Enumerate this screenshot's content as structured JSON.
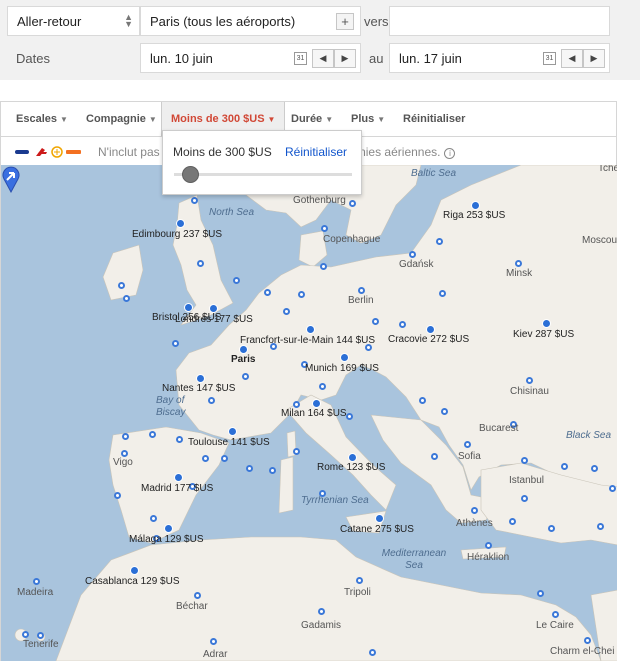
{
  "search": {
    "trip_type": "Aller-retour",
    "origin": "Paris (tous les aéroports)",
    "add_label": "+",
    "vers_label": "vers",
    "destination_value": "",
    "dates_label": "Dates",
    "depart_date": "lun. 10 juin",
    "au_label": "au",
    "return_date": "lun. 17 juin",
    "cal_label": "31",
    "prev": "◀",
    "next": "▶"
  },
  "filters": {
    "stops": "Escales",
    "airline": "Compagnie",
    "price": "Moins de 300 $US",
    "duration": "Durée",
    "more": "Plus",
    "reset": "Réinitialiser",
    "caret": "▼"
  },
  "airline_note": "N'inclut pas les tarifs de certaines autres compagnies aériennes.",
  "info_icon": "i",
  "price_popup": {
    "label": "Moins de 300 $US",
    "reset": "Réinitialiser",
    "slider_fraction": 0.1
  },
  "map": {
    "origin_label": "Paris",
    "cities": [
      {
        "name": "Edimbourg 237 $US"
      },
      {
        "name": "Bristol 256 $US"
      },
      {
        "name": "Londres 177 $US"
      },
      {
        "name": "Riga 253 $US"
      },
      {
        "name": "Francfort-sur-le-Main 144 $US"
      },
      {
        "name": "Cracovie 272 $US"
      },
      {
        "name": "Kiev 287 $US"
      },
      {
        "name": "Munich 169 $US"
      },
      {
        "name": "Nantes 147 $US"
      },
      {
        "name": "Milan 164 $US"
      },
      {
        "name": "Toulouse 141 $US"
      },
      {
        "name": "Rome 123 $US"
      },
      {
        "name": "Madrid 177 $US"
      },
      {
        "name": "Málaga 129 $US"
      },
      {
        "name": "Catane 275 $US"
      },
      {
        "name": "Casablanca 129 $US"
      }
    ],
    "places": [
      "Gothenburg",
      "Copenhague",
      "Berlin",
      "Gdańsk",
      "Minsk",
      "Moscou",
      "Chisinau",
      "Bucarest",
      "Sofia",
      "Istanbul",
      "Athènes",
      "Héraklion",
      "Le Caire",
      "Charm el-Chei",
      "Tripoli",
      "Béchar",
      "Gadamis",
      "Adrar",
      "Madeira",
      "Tenerife",
      "Vigo",
      "Tche"
    ],
    "seas": [
      "North Sea",
      "Baltic Sea",
      "Bay of Biscay",
      "Black Sea",
      "Tyrrhenian Sea",
      "Mediterranean Sea"
    ]
  },
  "colors": {
    "accent_red": "#d14836",
    "link_blue": "#1155cc",
    "sea": "#a9c4dd",
    "land": "#f2efe9",
    "marker": "#2b6fd6"
  }
}
